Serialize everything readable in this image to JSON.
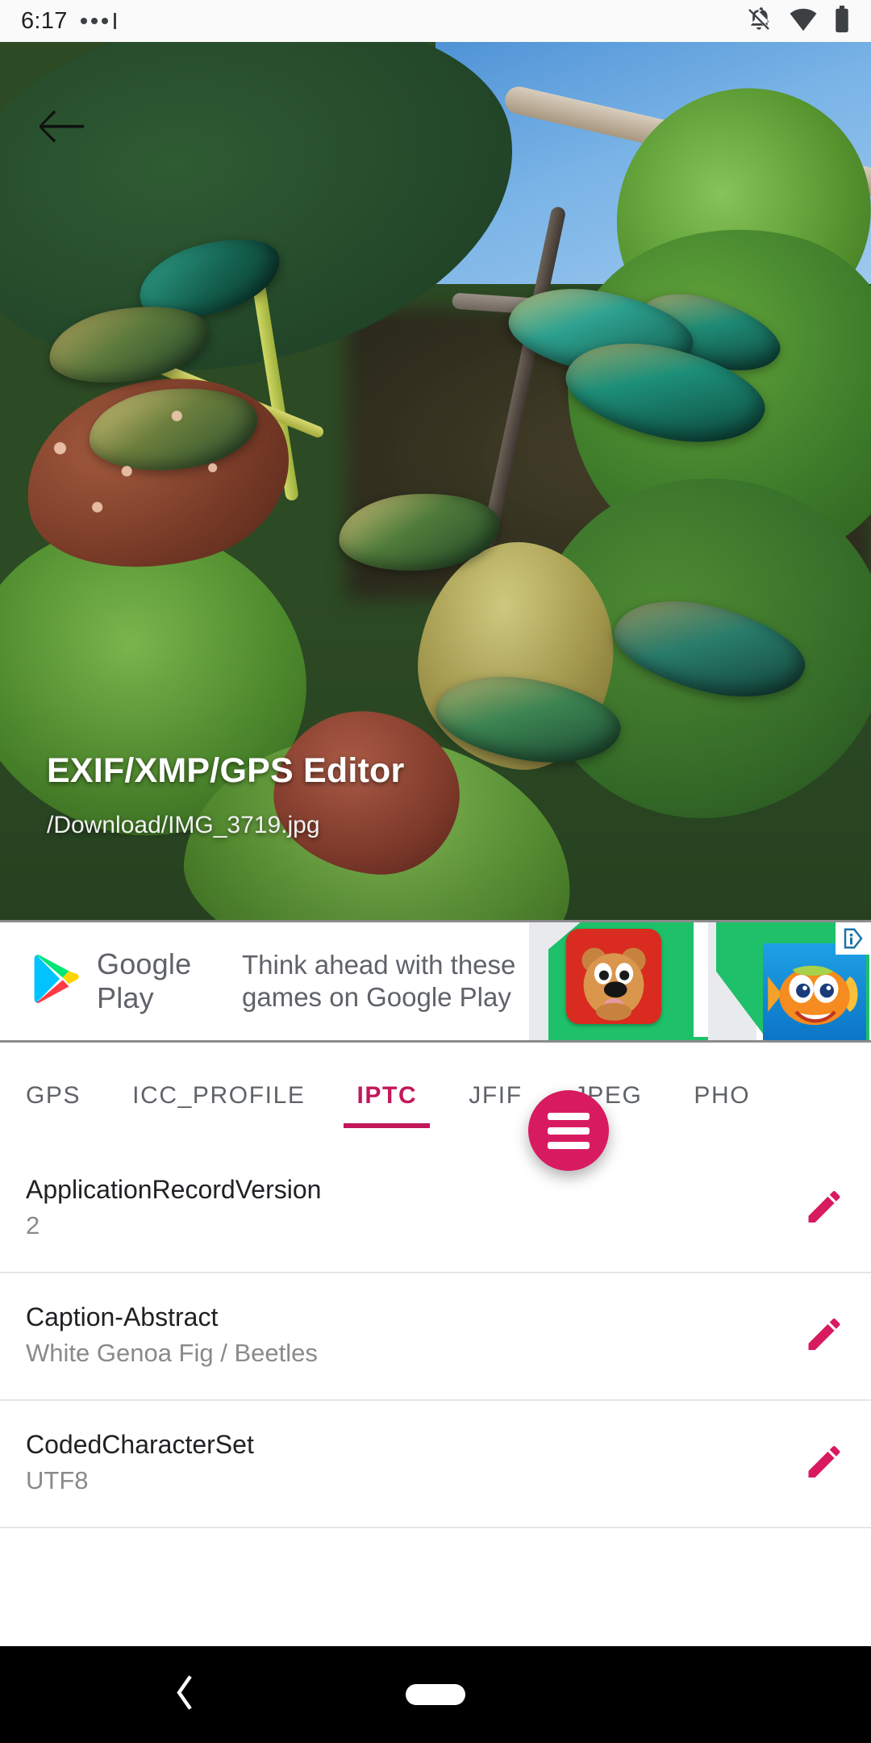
{
  "statusbar": {
    "time": "6:17",
    "icons": [
      "notifications-off-icon",
      "wifi-icon",
      "battery-icon"
    ]
  },
  "hero": {
    "back_label": "←",
    "title": "EXIF/XMP/GPS Editor",
    "subtitle": "/Download/IMG_3719.jpg"
  },
  "ad": {
    "brand": "Google Play",
    "copy": "Think ahead with these games on Google Play",
    "badge": "AdChoices"
  },
  "tabs": {
    "items": [
      {
        "label": "GPS",
        "active": false
      },
      {
        "label": "ICC_PROFILE",
        "active": false
      },
      {
        "label": "IPTC",
        "active": true
      },
      {
        "label": "JFIF",
        "active": false
      },
      {
        "label": "JPEG",
        "active": false
      },
      {
        "label": "PHO",
        "active": false
      }
    ],
    "active_index": 2,
    "accent_color": "#c2185b"
  },
  "list": {
    "rows": [
      {
        "key": "ApplicationRecordVersion",
        "value": "2",
        "action": "edit-icon"
      },
      {
        "key": "Caption-Abstract",
        "value": "White Genoa Fig / Beetles",
        "action": "edit-icon"
      },
      {
        "key": "CodedCharacterSet",
        "value": "UTF8",
        "action": "edit-icon"
      }
    ]
  },
  "fab": {
    "icon": "hamburger-menu-icon",
    "color": "#d81b60"
  },
  "navbar": {
    "back": "back-chevron-icon",
    "home": "home-pill-icon"
  }
}
